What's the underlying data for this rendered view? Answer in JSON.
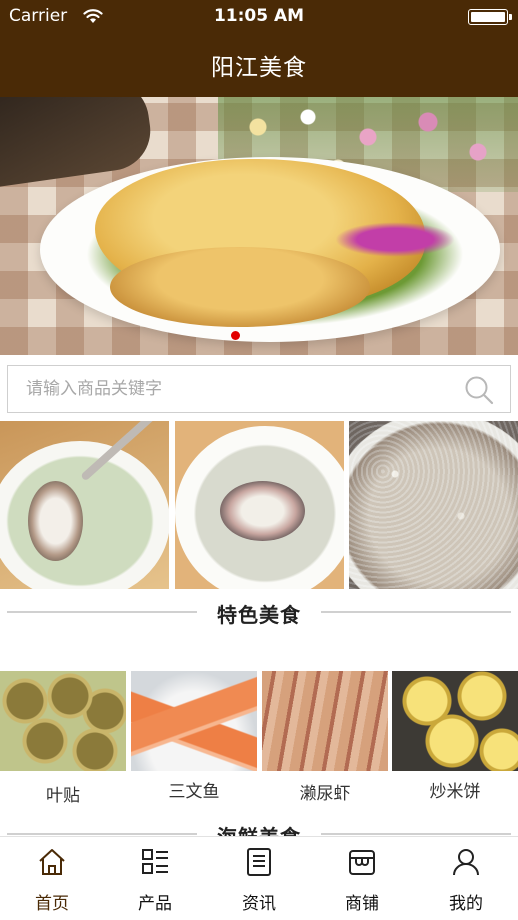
{
  "status_bar": {
    "carrier": "Carrier",
    "time": "11:05 AM"
  },
  "nav": {
    "title": "阳江美食"
  },
  "banner": {
    "active_index": 0,
    "page_count": 1
  },
  "search": {
    "placeholder": "请输入商品关键字"
  },
  "sections": {
    "featured": "特色美食",
    "seafood": "海鲜美食"
  },
  "products": [
    {
      "name": "叶贴"
    },
    {
      "name": "三文鱼"
    },
    {
      "name": "濑尿虾"
    },
    {
      "name": "炒米饼"
    }
  ],
  "tabbar": {
    "items": [
      {
        "label": "首页",
        "icon": "home-icon",
        "active": true
      },
      {
        "label": "产品",
        "icon": "grid-list-icon",
        "active": false
      },
      {
        "label": "资讯",
        "icon": "news-icon",
        "active": false
      },
      {
        "label": "商铺",
        "icon": "store-icon",
        "active": false
      },
      {
        "label": "我的",
        "icon": "user-icon",
        "active": false
      }
    ]
  },
  "colors": {
    "header_bg": "#4a2a06",
    "banner_dot": "#e20000"
  }
}
